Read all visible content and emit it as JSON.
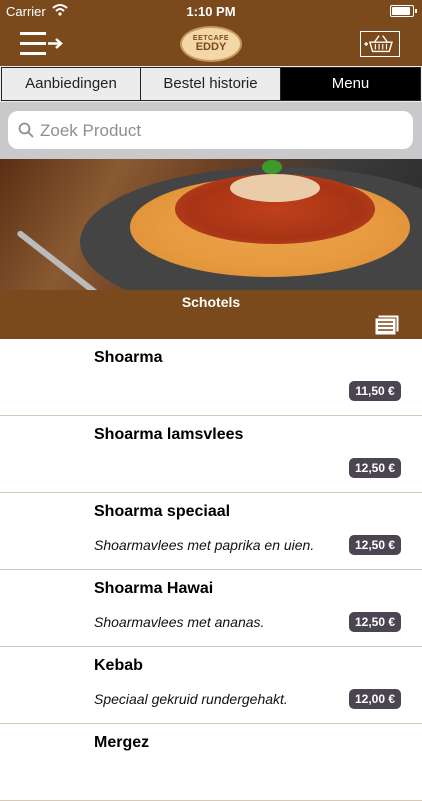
{
  "status_bar": {
    "carrier": "Carrier",
    "time": "1:10 PM"
  },
  "header": {
    "logo_small": "EETCAFE",
    "logo_big": "EDDY"
  },
  "tabs": [
    {
      "label": "Aanbiedingen",
      "active": false
    },
    {
      "label": "Bestel historie",
      "active": false
    },
    {
      "label": "Menu",
      "active": true
    }
  ],
  "search": {
    "placeholder": "Zoek Product",
    "value": ""
  },
  "category": {
    "title": "Schotels"
  },
  "products": [
    {
      "name": "Shoarma",
      "description": "",
      "price": "11,50 €"
    },
    {
      "name": "Shoarma lamsvlees",
      "description": "",
      "price": "12,50 €"
    },
    {
      "name": "Shoarma speciaal",
      "description": "Shoarmavlees met paprika en uien.",
      "price": "12,50 €"
    },
    {
      "name": "Shoarma Hawai",
      "description": "Shoarmavlees met ananas.",
      "price": "12,50 €"
    },
    {
      "name": "Kebab",
      "description": "Speciaal gekruid rundergehakt.",
      "price": "12,00 €"
    },
    {
      "name": "Mergez",
      "description": "",
      "price": ""
    }
  ],
  "icons": {
    "menu": "menu-arrow-icon",
    "basket": "basket-icon",
    "search": "search-icon",
    "list": "list-view-icon"
  },
  "colors": {
    "brand_brown": "#7a4a1c",
    "price_badge": "#4a4550",
    "active_tab": "#000000"
  }
}
